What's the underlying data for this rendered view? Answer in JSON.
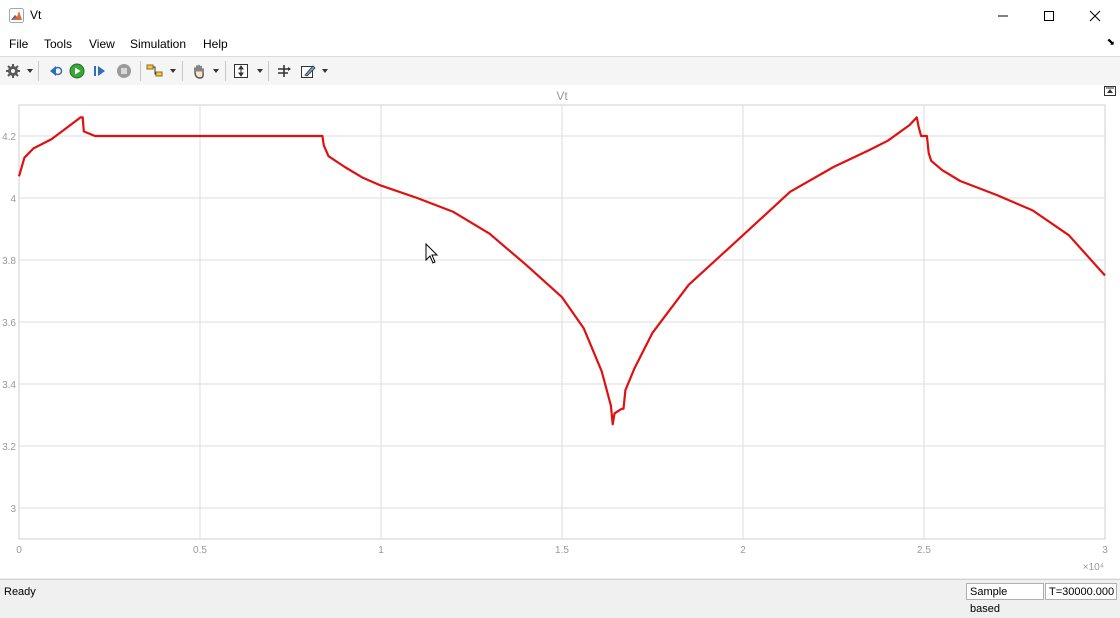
{
  "window": {
    "title": "Vt",
    "minimize_glyph": "—",
    "maximize_glyph": "☐",
    "close_glyph": "✕"
  },
  "menu": {
    "items": [
      "File",
      "Tools",
      "View",
      "Simulation",
      "Help"
    ],
    "pin_glyph": "⬊"
  },
  "toolbar": {
    "buttons": [
      "settings-gear-icon",
      "step-back-icon",
      "run-icon",
      "step-forward-icon",
      "stop-icon",
      "signal-select-icon",
      "pan-hand-icon",
      "zoom-autoscale-icon",
      "cursor-measure-icon",
      "style-edit-icon"
    ]
  },
  "status": {
    "left": "Ready",
    "mode": "Sample based",
    "time": "T=30000.000"
  },
  "colors": {
    "trace": "#e01010",
    "grid": "#dedede",
    "axis_text": "#999999"
  },
  "chart_data": {
    "type": "line",
    "title": "Vt",
    "xlabel": "",
    "ylabel": "",
    "xlim": [
      0,
      30000
    ],
    "ylim": [
      2.9,
      4.3
    ],
    "x_ticks": [
      0,
      0.5,
      1,
      1.5,
      2,
      2.5,
      3
    ],
    "x_tick_labels": [
      "0",
      "0.5",
      "1",
      "1.5",
      "2",
      "2.5",
      "3"
    ],
    "x_exponent_label": "×10⁴",
    "y_ticks": [
      3,
      3.2,
      3.4,
      3.6,
      3.8,
      4,
      4.2
    ],
    "y_tick_labels": [
      "3",
      "3.2",
      "3.4",
      "3.6",
      "3.8",
      "4",
      "4.2"
    ],
    "grid": true,
    "series": [
      {
        "color": "#e01010",
        "x": [
          0,
          150,
          400,
          900,
          1300,
          1700,
          1760,
          1790,
          2100,
          3000,
          5000,
          7000,
          8380,
          8420,
          8550,
          9000,
          9500,
          10000,
          11000,
          12000,
          13000,
          14000,
          15000,
          15600,
          16100,
          16350,
          16400,
          16450,
          16650,
          16700,
          16750,
          17000,
          17500,
          18500,
          20000,
          21300,
          22500,
          23500,
          24000,
          24600,
          24800,
          24850,
          24920,
          25080,
          25130,
          25200,
          25500,
          26000,
          27000,
          28000,
          29000,
          30000
        ],
        "y": [
          4.07,
          4.13,
          4.16,
          4.19,
          4.225,
          4.26,
          4.26,
          4.215,
          4.2,
          4.2,
          4.2,
          4.2,
          4.2,
          4.17,
          4.135,
          4.1,
          4.065,
          4.04,
          4.0,
          3.955,
          3.885,
          3.785,
          3.68,
          3.58,
          3.44,
          3.33,
          3.27,
          3.305,
          3.32,
          3.32,
          3.38,
          3.45,
          3.565,
          3.72,
          3.88,
          4.02,
          4.1,
          4.155,
          4.185,
          4.235,
          4.26,
          4.23,
          4.2,
          4.2,
          4.145,
          4.12,
          4.09,
          4.055,
          4.01,
          3.96,
          3.88,
          3.75
        ]
      }
    ]
  }
}
